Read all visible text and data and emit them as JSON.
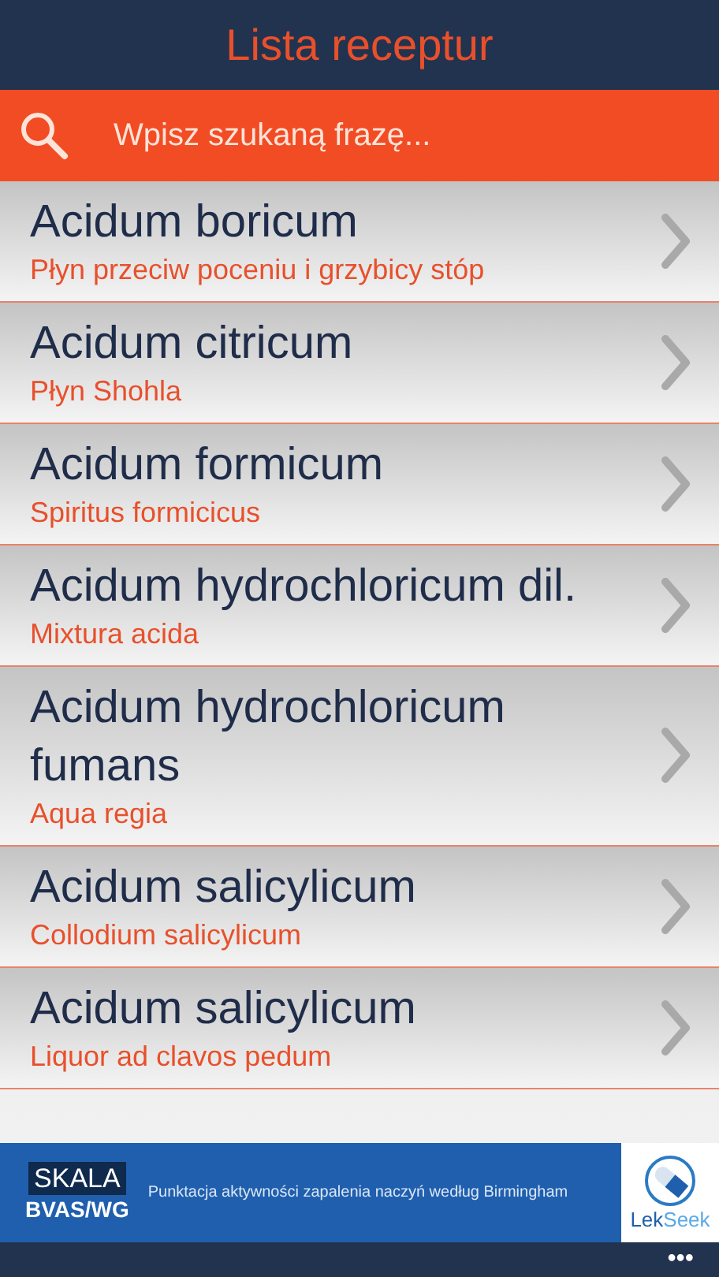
{
  "header": {
    "title": "Lista receptur"
  },
  "search": {
    "placeholder": "Wpisz szukaną frazę..."
  },
  "items": [
    {
      "name": "Acidum boricum",
      "subtitle": "Płyn przeciw poceniu i grzybicy stóp"
    },
    {
      "name": "Acidum citricum",
      "subtitle": "Płyn Shohla"
    },
    {
      "name": "Acidum formicum",
      "subtitle": "Spiritus formicicus"
    },
    {
      "name": "Acidum hydrochloricum dil.",
      "subtitle": "Mixtura acida"
    },
    {
      "name": "Acidum hydrochloricum fumans",
      "subtitle": "Aqua regia"
    },
    {
      "name": "Acidum salicylicum",
      "subtitle": "Collodium salicylicum"
    },
    {
      "name": "Acidum salicylicum",
      "subtitle": "Liquor ad clavos pedum"
    }
  ],
  "ad": {
    "badge_top": "SKALA",
    "badge_bottom": "BVAS/WG",
    "text": "Punktacja aktywności zapalenia naczyń według Birmingham",
    "brand": [
      "Lek",
      "Seek"
    ]
  },
  "app_bar": {
    "more": "•••"
  }
}
